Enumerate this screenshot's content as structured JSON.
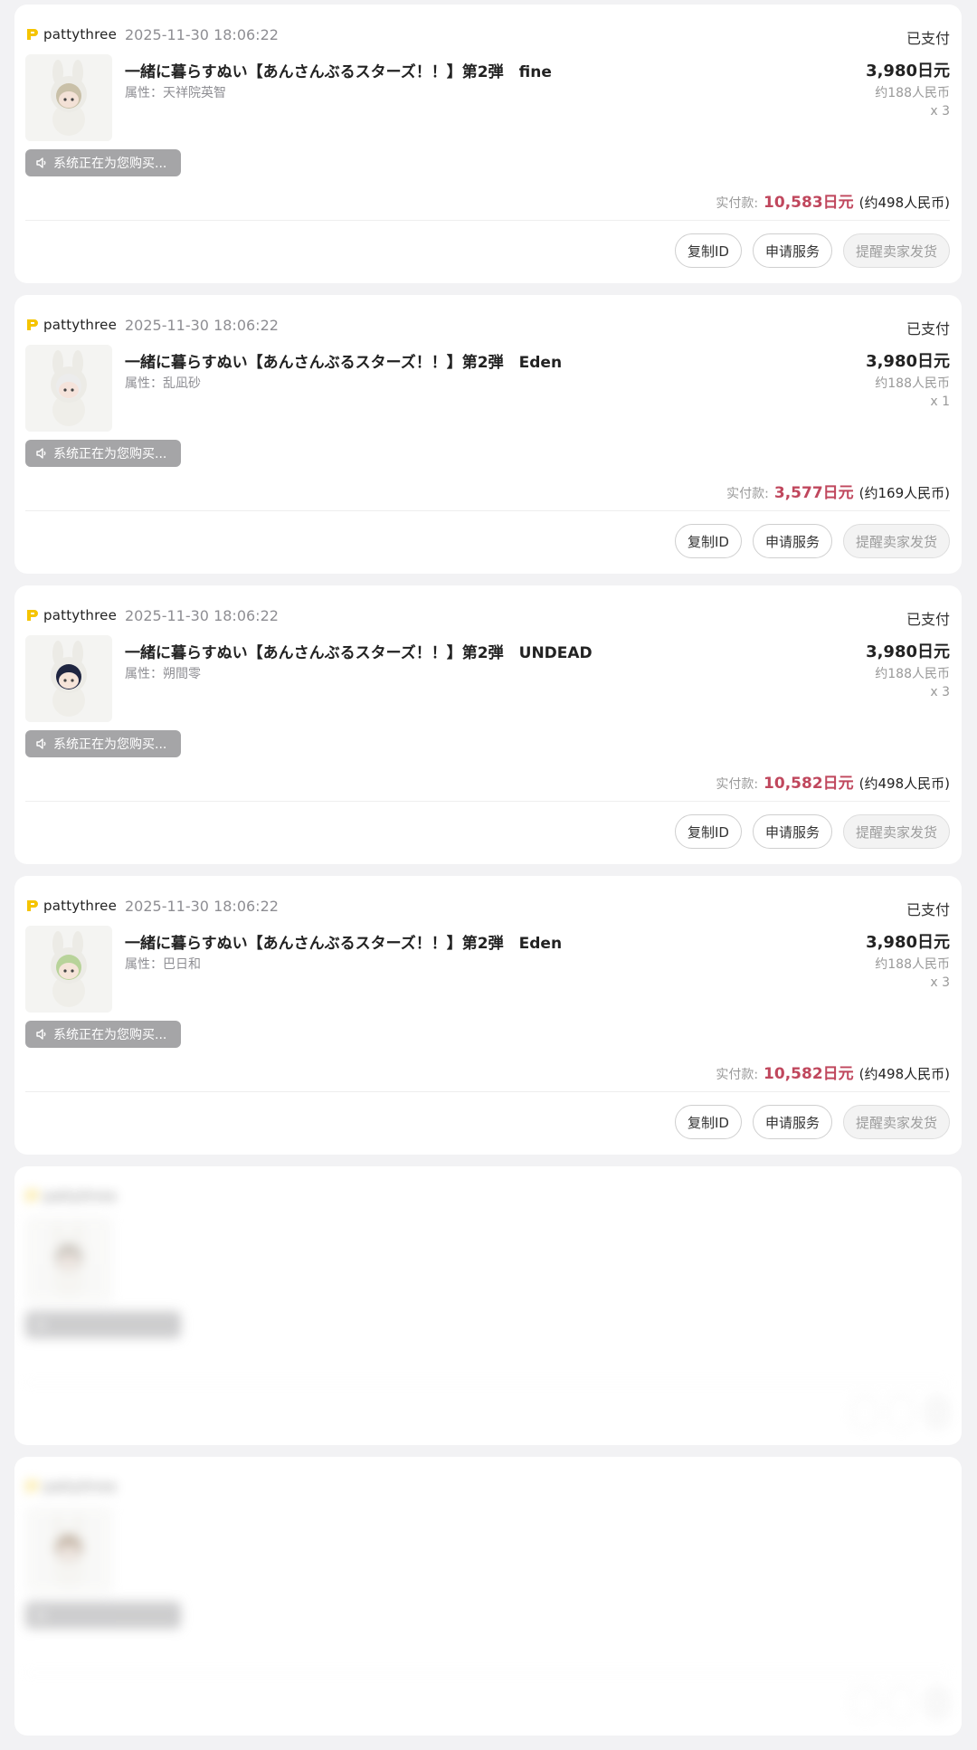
{
  "orders": [
    {
      "shop": "pattythree",
      "time": "2025-11-30 18:06:22",
      "status": "已支付",
      "title": "一緒に暮らすぬい【あんさんぶるスターズ！！】第2弾　fine",
      "attr": "属性：天祥院英智",
      "price": "3,980日元",
      "price_cny": "约188人民币",
      "qty": "x 3",
      "buying": "系统正在为您购买...",
      "paid_label": "实付款:",
      "paid_amount": "10,583日元",
      "paid_cny": "(约498人民币)",
      "btn_copy": "复制ID",
      "btn_service": "申请服务",
      "btn_remind": "提醒卖家发货",
      "hair_color": "#c9c0a8",
      "face_color": "#f3e1d6"
    },
    {
      "shop": "pattythree",
      "time": "2025-11-30 18:06:22",
      "status": "已支付",
      "title": "一緒に暮らすぬい【あんさんぶるスターズ！！】第2弾　Eden",
      "attr": "属性：乱凪砂",
      "price": "3,980日元",
      "price_cny": "约188人民币",
      "qty": "x 1",
      "buying": "系统正在为您购买...",
      "paid_label": "实付款:",
      "paid_amount": "3,577日元",
      "paid_cny": "(约169人民币)",
      "btn_copy": "复制ID",
      "btn_service": "申请服务",
      "btn_remind": "提醒卖家发货",
      "hair_color": "#ececec",
      "face_color": "#f5e3db"
    },
    {
      "shop": "pattythree",
      "time": "2025-11-30 18:06:22",
      "status": "已支付",
      "title": "一緒に暮らすぬい【あんさんぶるスターズ！！】第2弾　UNDEAD",
      "attr": "属性：朔間零",
      "price": "3,980日元",
      "price_cny": "约188人民币",
      "qty": "x 3",
      "buying": "系统正在为您购买...",
      "paid_label": "实付款:",
      "paid_amount": "10,582日元",
      "paid_cny": "(约498人民币)",
      "btn_copy": "复制ID",
      "btn_service": "申请服务",
      "btn_remind": "提醒卖家发货",
      "hair_color": "#1f2540",
      "face_color": "#f6e4d9"
    },
    {
      "shop": "pattythree",
      "time": "2025-11-30 18:06:22",
      "status": "已支付",
      "title": "一緒に暮らすぬい【あんさんぶるスターズ！！】第2弾　Eden",
      "attr": "属性：巴日和",
      "price": "3,980日元",
      "price_cny": "约188人民币",
      "qty": "x 3",
      "buying": "系统正在为您购买...",
      "paid_label": "实付款:",
      "paid_amount": "10,582日元",
      "paid_cny": "(约498人民币)",
      "btn_copy": "复制ID",
      "btn_service": "申请服务",
      "btn_remind": "提醒卖家发货",
      "hair_color": "#b8d39a",
      "face_color": "#f5e4d8"
    },
    {
      "shop": "pattythree",
      "time": "",
      "status": "",
      "title": "",
      "attr": "",
      "price": "",
      "price_cny": "",
      "qty": "",
      "buying": "",
      "paid_label": "",
      "paid_amount": "",
      "paid_cny": "",
      "btn_copy": "",
      "btn_service": "",
      "btn_remind": "",
      "hair_color": "#8a8072",
      "face_color": "#f2e2d8",
      "blurred": true
    },
    {
      "shop": "pattythree",
      "time": "",
      "status": "",
      "title": "",
      "attr": "",
      "price": "",
      "price_cny": "",
      "qty": "",
      "buying": "",
      "paid_label": "",
      "paid_amount": "",
      "paid_cny": "",
      "btn_copy": "",
      "btn_service": "",
      "btn_remind": "",
      "hair_color": "#7a5a3a",
      "face_color": "#f2e2d8",
      "blurred": true
    }
  ],
  "colors": {
    "accent_price": "#c0475d",
    "badge_gray": "#a5a5a7",
    "logo_yellow": "#f5c400"
  },
  "icons": {
    "shop_logo": "pattythree-logo-icon",
    "speaker": "speaker-icon"
  }
}
